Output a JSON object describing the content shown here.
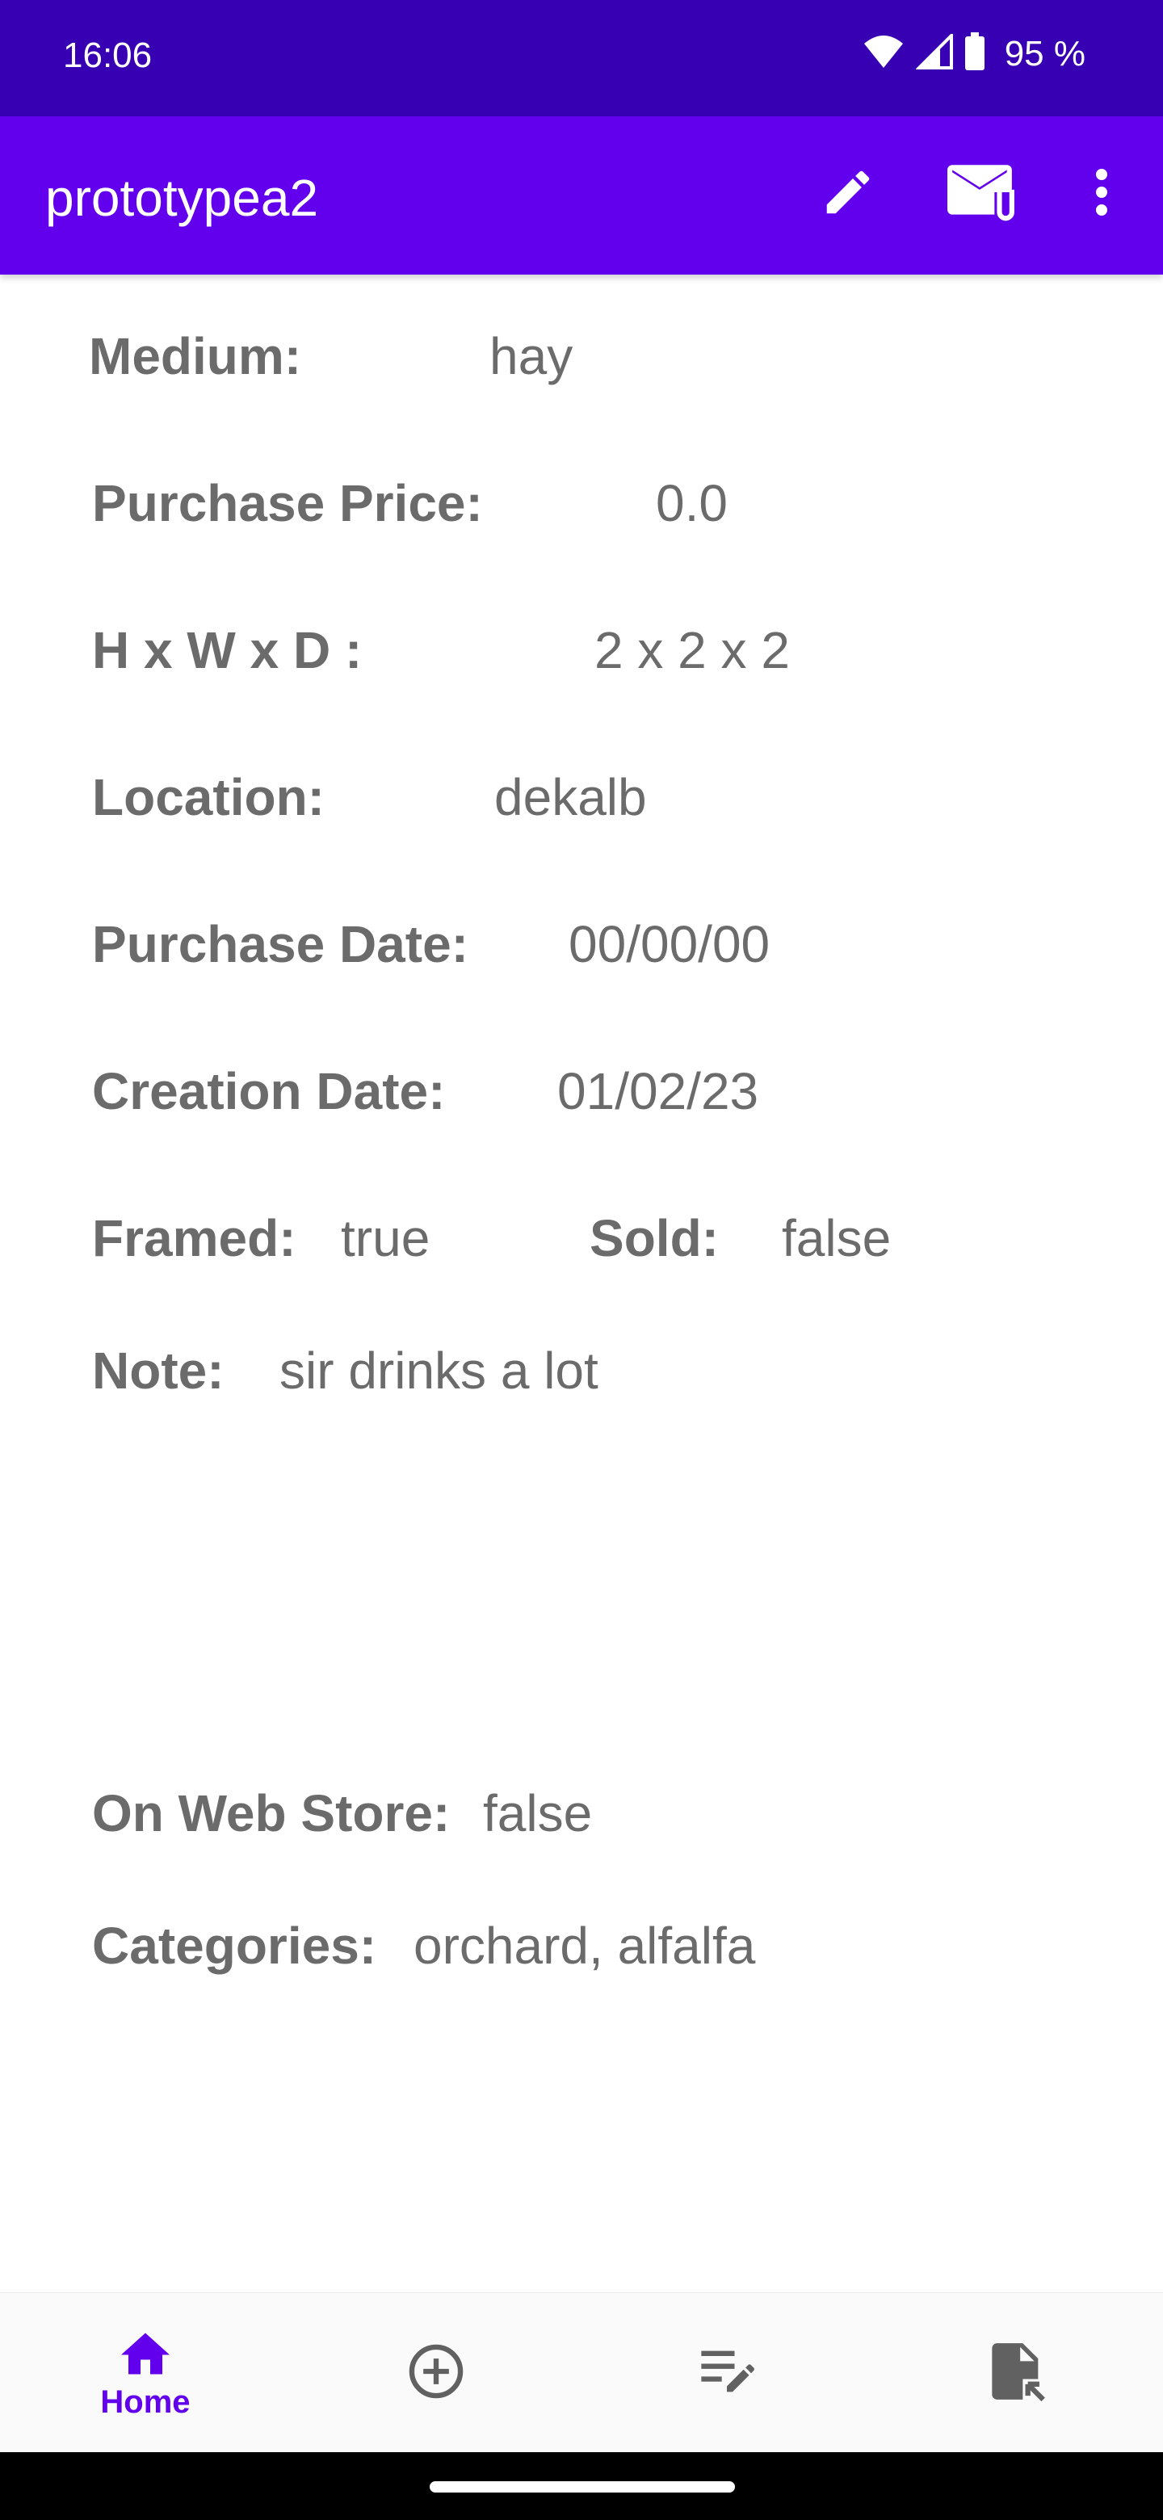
{
  "status_bar": {
    "time": "16:06",
    "battery_text": "95 %",
    "icons": [
      "wifi-icon",
      "signal-icon",
      "battery-icon"
    ]
  },
  "app_bar": {
    "title": "prototypea2",
    "actions": [
      "edit-icon",
      "mail-attachment-icon",
      "more-vert-icon"
    ],
    "background": "#6200ee"
  },
  "details": {
    "medium_label": "Medium:",
    "medium_value": "hay",
    "purchase_price_label": "Purchase Price:",
    "purchase_price_value": "0.0",
    "dimensions_label": "H x W x D :",
    "dimensions_value": "2 x 2 x 2",
    "location_label": "Location:",
    "location_value": "dekalb",
    "purchase_date_label": "Purchase Date:",
    "purchase_date_value": "00/00/00",
    "creation_date_label": "Creation Date:",
    "creation_date_value": "01/02/23",
    "framed_label": "Framed:",
    "framed_value": "true",
    "sold_label": "Sold:",
    "sold_value": "false",
    "note_label": "Note:",
    "note_value": "sir drinks a lot",
    "web_store_label": "On Web Store:",
    "web_store_value": "false",
    "categories_label": "Categories:",
    "categories_value": "orchard, alfalfa"
  },
  "bottom_nav": {
    "items": [
      {
        "icon": "home-icon",
        "label": "Home",
        "active": true
      },
      {
        "icon": "add-circle-icon",
        "label": "",
        "active": false
      },
      {
        "icon": "edit-list-icon",
        "label": "",
        "active": false
      },
      {
        "icon": "export-file-icon",
        "label": "",
        "active": false
      }
    ],
    "active_color": "#6200ee",
    "inactive_color": "#616161"
  },
  "colors": {
    "status_bar": "#3700b3",
    "text": "#6b6b6b"
  }
}
